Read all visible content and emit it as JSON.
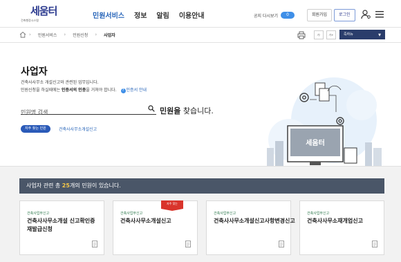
{
  "header": {
    "logo_text": "세움터",
    "logo_sub": "건축행정시스템",
    "nav": [
      {
        "label": "민원서비스",
        "active": true
      },
      {
        "label": "정보",
        "active": false
      },
      {
        "label": "알림",
        "active": false
      },
      {
        "label": "이용안내",
        "active": false
      }
    ],
    "notice_label": "공지 다시보기",
    "notice_toggle": "0",
    "join_label": "회원가입",
    "login_label": "로그인",
    "accent_color": "#2563b8"
  },
  "breadcrumb": {
    "items": [
      "민원서비스",
      "민원신청",
      "사업자"
    ],
    "tools": [
      "가-",
      "가+"
    ],
    "quick_menu": "즉하뉴"
  },
  "hero": {
    "title": "사업자",
    "desc1": "건축사사무소 개설신고와 관련된 업무입니다.",
    "desc2_prefix": "민원신청을 하실때에는 ",
    "desc2_bold": "인증서의 인증",
    "desc2_suffix": "을 거쳐야 합니다.",
    "guide_link": "인증서 안내",
    "search_placeholder": "민원명 검색",
    "find_bold": "민원을",
    "find_rest": " 찾습니다.",
    "freq_badge": "자주 찾는 민원",
    "freq_link": "건축사사무소개설신고",
    "illust_monitor_text": "세움터"
  },
  "results": {
    "prefix": "사업자 관련 총 ",
    "count": "25",
    "suffix": "개의 민원이 있습니다.",
    "cards": [
      {
        "category": "건축사업무신고",
        "name": "건축사사무소개설 신고확인증 재발급신청",
        "badge": ""
      },
      {
        "category": "건축사업무신고",
        "name": "건축사사무소개설신고",
        "badge": "자주 찾는"
      },
      {
        "category": "건축사업무신고",
        "name": "건축사사무소개설신고사항변경신고",
        "badge": ""
      },
      {
        "category": "건축사업무신고",
        "name": "건축사사무소재개업신고",
        "badge": ""
      }
    ]
  }
}
